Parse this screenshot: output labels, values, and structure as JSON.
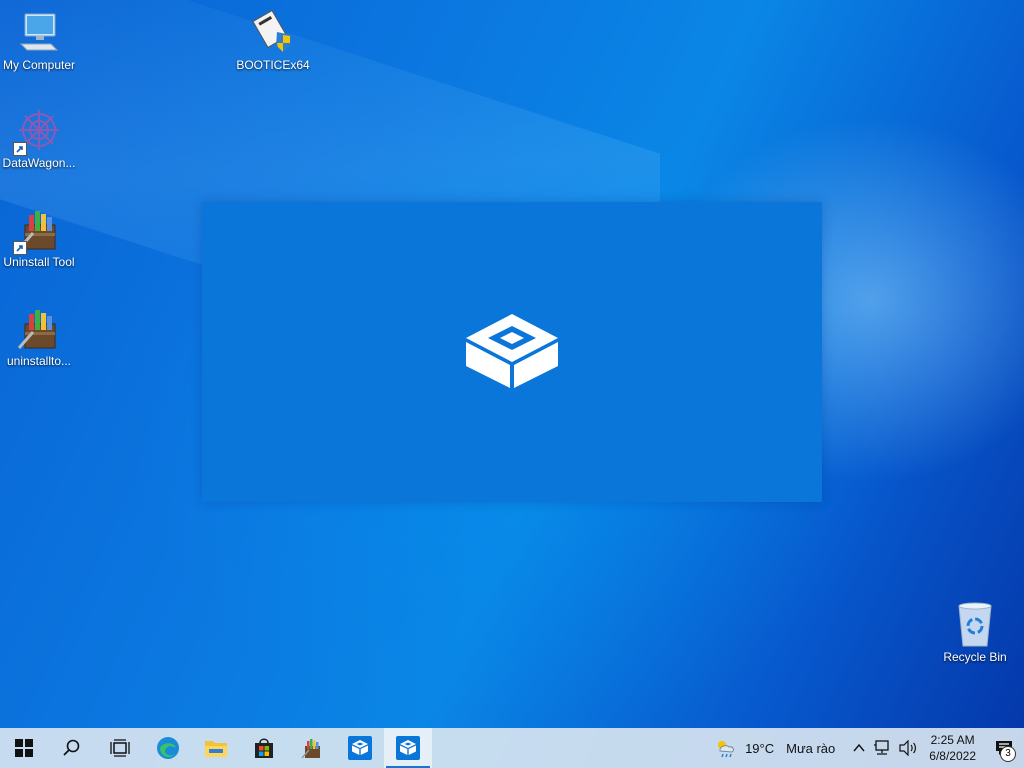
{
  "desktop": {
    "icons": [
      {
        "label": "My Computer"
      },
      {
        "label": "BOOTICEx64"
      },
      {
        "label": "DataWagon..."
      },
      {
        "label": "Uninstall Tool"
      },
      {
        "label": "uninstallto..."
      },
      {
        "label": "Recycle Bin"
      }
    ]
  },
  "taskbar": {
    "buttons": [
      {
        "icon": "windows-start-icon"
      },
      {
        "icon": "search-icon"
      },
      {
        "icon": "task-view-icon"
      },
      {
        "icon": "edge-browser-icon"
      },
      {
        "icon": "file-explorer-icon"
      },
      {
        "icon": "microsoft-store-icon"
      },
      {
        "icon": "uninstall-tool-icon"
      },
      {
        "icon": "sandbox-icon"
      },
      {
        "icon": "sandbox-icon-active"
      }
    ],
    "tray": {
      "temperature": "19°C",
      "weather": "Mưa rào",
      "time": "2:25 AM",
      "date": "6/8/2022",
      "notification_count": "3"
    }
  },
  "colors": {
    "splash_bg": "#0a76da",
    "accent": "#1a73d6"
  }
}
